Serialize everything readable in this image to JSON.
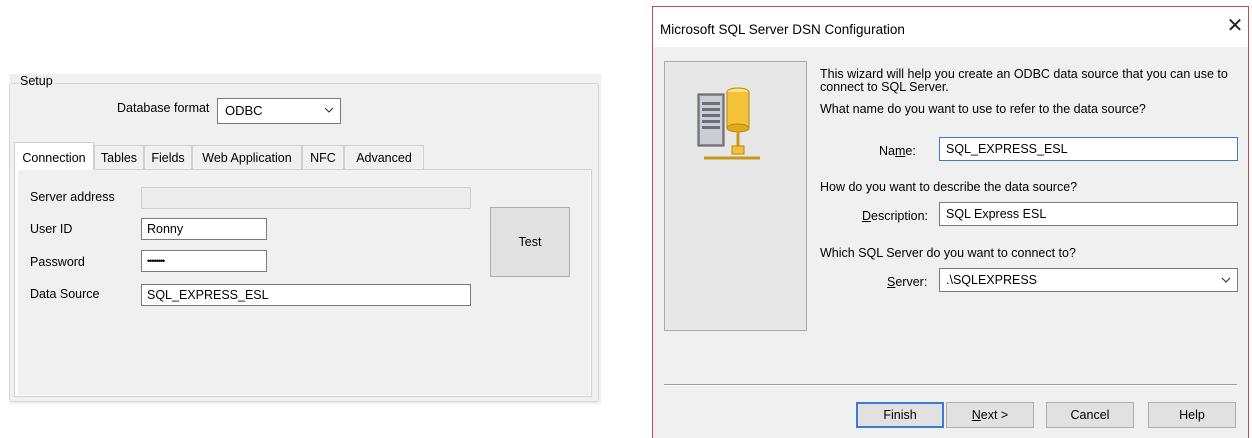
{
  "setup": {
    "group_label": "Setup",
    "database_format_label": "Database format",
    "database_format_value": "ODBC",
    "tabs": [
      "Connection",
      "Tables",
      "Fields",
      "Web Application",
      "NFC",
      "Advanced"
    ],
    "active_tab": "Connection",
    "connection": {
      "server_address_label": "Server address",
      "server_address_value": "",
      "user_id_label": "User ID",
      "user_id_value": "Ronny",
      "password_label": "Password",
      "password_value": "••••••••",
      "data_source_label": "Data Source",
      "data_source_value": "SQL_EXPRESS_ESL",
      "test_button": "Test"
    }
  },
  "dsn_dialog": {
    "title": "Microsoft SQL Server DSN Configuration",
    "close_glyph": "✕",
    "intro_line1": "This wizard will help you create an ODBC data source that you can use to",
    "intro_line2": "connect to SQL Server.",
    "name_question": "What name do you want to use to refer to the data source?",
    "name_label_pre": "Na",
    "name_label_mnemonic": "m",
    "name_label_post": "e:",
    "name_value": "SQL_EXPRESS_ESL",
    "description_question": "How do you want to describe the data source?",
    "description_label_mnemonic": "D",
    "description_label_post": "escription:",
    "description_value": "SQL Express ESL",
    "server_question": "Which SQL Server do you want to connect to?",
    "server_label_mnemonic": "S",
    "server_label_post": "erver:",
    "server_value": ".\\SQLEXPRESS",
    "buttons": {
      "finish": "Finish",
      "next_mnemonic": "N",
      "next_post": "ext >",
      "cancel": "Cancel",
      "help": "Help"
    },
    "icon": "server-database-network-icon"
  }
}
